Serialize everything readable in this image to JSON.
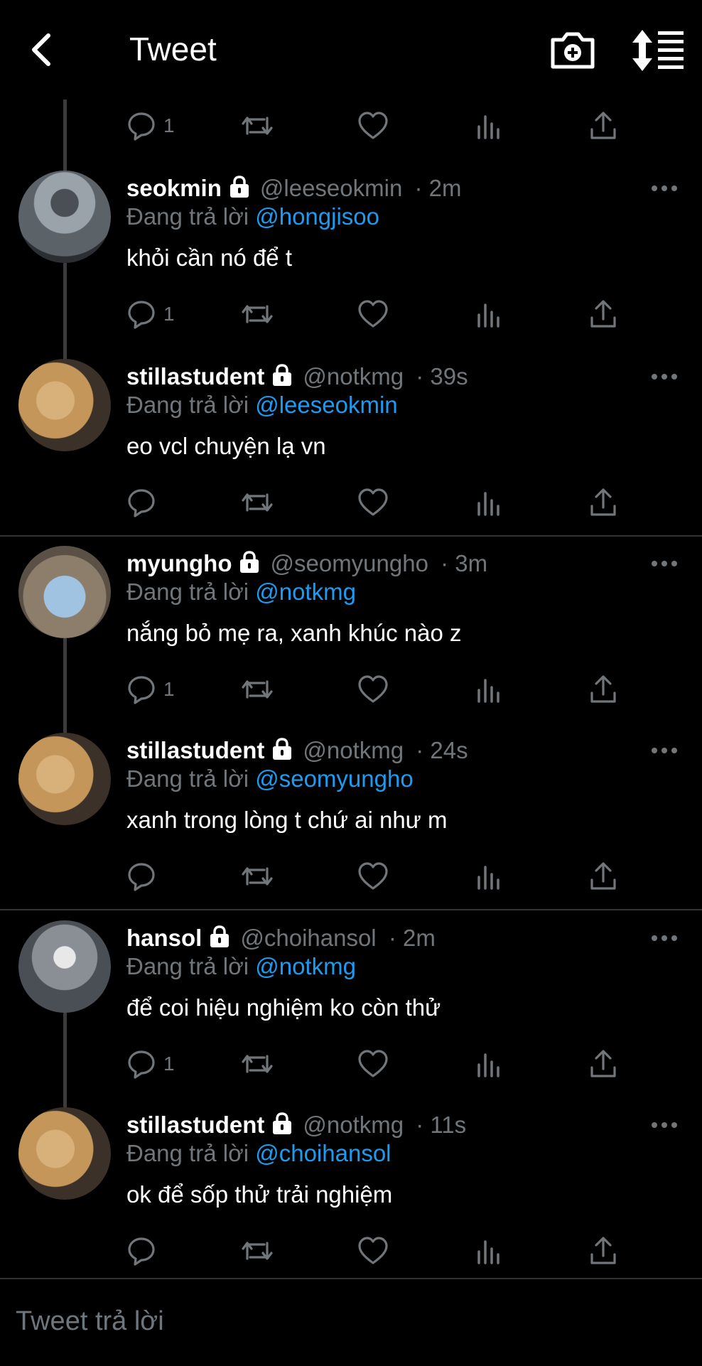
{
  "header": {
    "title": "Tweet",
    "back_icon": "chevron-left-icon",
    "camera_icon": "camera-plus-icon",
    "sort_icon": "sort-icon"
  },
  "top_actions": {
    "reply_count": "1"
  },
  "tweets": [
    {
      "name": "seokmin",
      "handle": "@leeseokmin",
      "time": "· 2m",
      "reply_prefix": "Đang trả lời",
      "reply_to": "@hongjisoo",
      "text": "khỏi cần nó để t",
      "reply_count": "1"
    },
    {
      "name": "stillastudent",
      "handle": "@notkmg",
      "time": "· 39s",
      "reply_prefix": "Đang trả lời",
      "reply_to": "@leeseokmin",
      "text": "eo vcl chuyện lạ vn",
      "reply_count": ""
    },
    {
      "name": "myungho",
      "handle": "@seomyungho",
      "time": "· 3m",
      "reply_prefix": "Đang trả lời",
      "reply_to": "@notkmg",
      "text": "nắng bỏ mẹ ra, xanh khúc nào z",
      "reply_count": "1"
    },
    {
      "name": "stillastudent",
      "handle": "@notkmg",
      "time": "· 24s",
      "reply_prefix": "Đang trả lời",
      "reply_to": "@seomyungho",
      "text": "xanh trong lòng t chứ ai như m",
      "reply_count": ""
    },
    {
      "name": "hansol",
      "handle": "@choihansol",
      "time": "· 2m",
      "reply_prefix": "Đang trả lời",
      "reply_to": "@notkmg",
      "text": "để coi hiệu nghiệm ko còn thử",
      "reply_count": "1"
    },
    {
      "name": "stillastudent",
      "handle": "@notkmg",
      "time": "· 11s",
      "reply_prefix": "Đang trả lời",
      "reply_to": "@choihansol",
      "text": "ok để sốp thử trải nghiệm",
      "reply_count": ""
    }
  ],
  "composer": {
    "placeholder": "Tweet trả lời"
  },
  "colors": {
    "background": "#000000",
    "accent": "#1d9bf0",
    "muted": "#71767b",
    "text": "#ffffff"
  }
}
